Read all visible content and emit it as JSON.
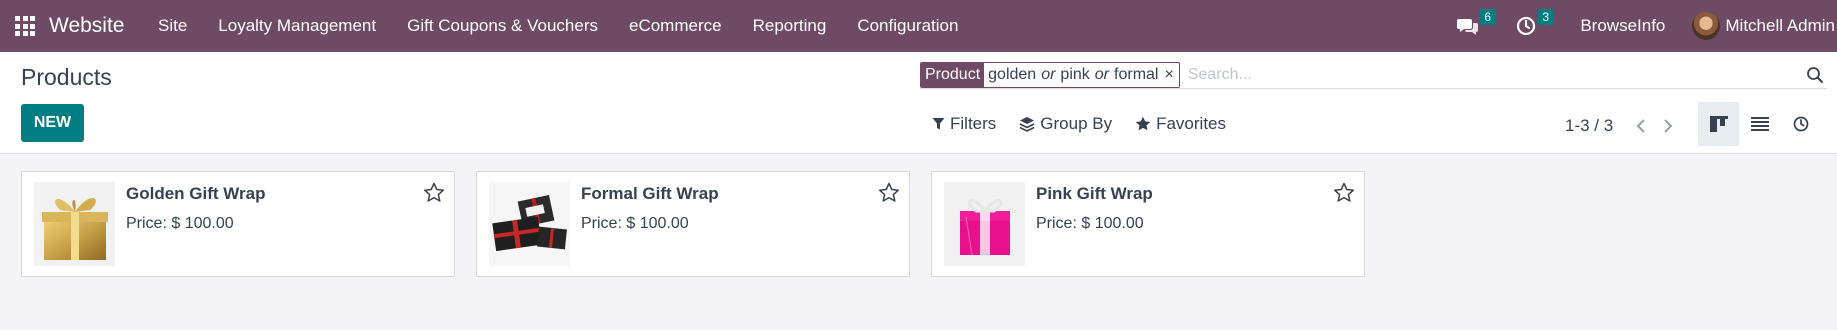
{
  "navbar": {
    "app_name": "Website",
    "menu": [
      "Site",
      "Loyalty Management",
      "Gift Coupons & Vouchers",
      "eCommerce",
      "Reporting",
      "Configuration"
    ],
    "messages_count": "6",
    "activities_count": "3",
    "browseinfo": "BrowseInfo",
    "user_name": "Mitchell Admin",
    "icons": {
      "apps": "apps-grid-icon",
      "messages": "chat-bubbles-icon",
      "activities": "clock-icon"
    }
  },
  "control_panel": {
    "title": "Products",
    "new_label": "NEW",
    "facet": {
      "label": "Product",
      "values": [
        "golden",
        "pink",
        "formal"
      ],
      "separator": "or"
    },
    "search_placeholder": "Search...",
    "filters_label": "Filters",
    "group_by_label": "Group By",
    "favorites_label": "Favorites",
    "pager_value": "1-3 / 3",
    "views": [
      "kanban",
      "list",
      "activity"
    ],
    "active_view": "kanban"
  },
  "products": [
    {
      "name": "Golden Gift Wrap",
      "price": "Price: $ 100.00",
      "image": "golden-gift-box",
      "color": "#c9a24a"
    },
    {
      "name": "Formal Gift Wrap",
      "price": "Price: $ 100.00",
      "image": "formal-gift-box",
      "color": "#2b2b2b"
    },
    {
      "name": "Pink Gift Wrap",
      "price": "Price: $ 100.00",
      "image": "pink-gift-box",
      "color": "#e8108c"
    }
  ],
  "colors": {
    "navbar": "#6e4a65",
    "primary": "#017e84",
    "background": "#f4f4f7"
  }
}
